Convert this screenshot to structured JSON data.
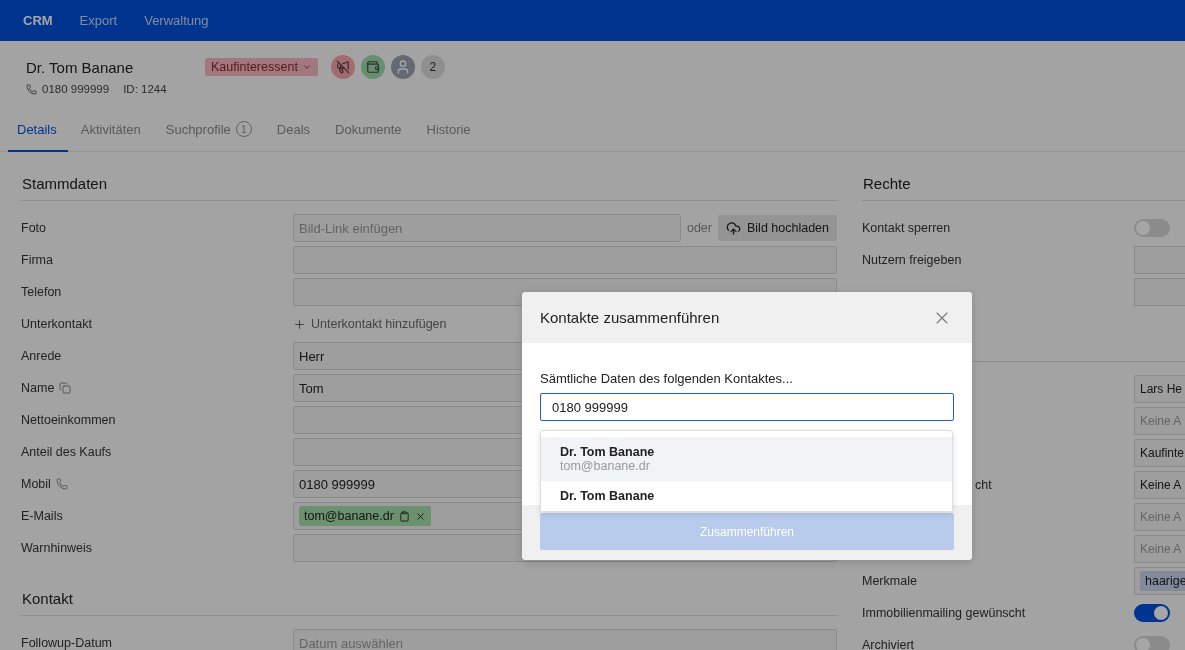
{
  "nav": [
    {
      "label": "CRM",
      "selected": true
    },
    {
      "label": "Export",
      "selected": false
    },
    {
      "label": "Verwaltung",
      "selected": false
    }
  ],
  "contact": {
    "name": "Dr. Tom Banane",
    "status": "Kaufinteressent",
    "badges": [
      {
        "kind": "megaphone-off"
      },
      {
        "kind": "wallet"
      },
      {
        "kind": "avatar"
      },
      {
        "kind": "count",
        "text": "2"
      }
    ],
    "phone": "0180 999999",
    "id": "ID: 1244"
  },
  "tabs": [
    {
      "label": "Details",
      "selected": true
    },
    {
      "label": "Aktivitäten",
      "selected": false
    },
    {
      "label": "Suchprofile",
      "count": "1",
      "selected": false
    },
    {
      "label": "Deals",
      "selected": false
    },
    {
      "label": "Dokumente",
      "selected": false
    },
    {
      "label": "Historie",
      "selected": false
    }
  ],
  "stammdaten": {
    "title": "Stammdaten",
    "rows": [
      {
        "label": "Foto",
        "kind": "photo",
        "placeholder": "Bild-Link einfügen",
        "or": "oder",
        "button": "Bild hochladen"
      },
      {
        "label": "Firma",
        "kind": "input"
      },
      {
        "label": "Telefon",
        "kind": "input"
      },
      {
        "label": "Unterkontakt",
        "kind": "add",
        "link": "Unterkontakt hinzufügen"
      },
      {
        "label": "Anrede",
        "kind": "input",
        "value": "Herr"
      },
      {
        "label": "Name",
        "label_action": {
          "kind": "copy"
        },
        "kind": "input",
        "value": "Tom"
      },
      {
        "label": "Nettoeinkommen",
        "kind": "input"
      },
      {
        "label": "Anteil des Kaufs",
        "kind": "input"
      },
      {
        "label": "Mobil",
        "label_action": {
          "kind": "phone"
        },
        "kind": "input",
        "value": "0180 999999"
      },
      {
        "label": "E-Mails",
        "kind": "tags",
        "tags": [
          "tom@banane.dr"
        ]
      },
      {
        "label": "Warnhinweis",
        "kind": "input"
      }
    ]
  },
  "kontakt": {
    "title": "Kontakt",
    "rows": [
      {
        "label": "Followup-Datum",
        "kind": "input",
        "placeholder": "Datum auswählen"
      }
    ]
  },
  "rechte": {
    "title": "Rechte",
    "rows": [
      {
        "label": "Kontakt sperren",
        "kind": "toggle",
        "on": false
      },
      {
        "label": "Nutzern freigeben",
        "kind": "input"
      },
      {
        "kind": "input"
      }
    ],
    "rows_2": [
      {
        "kind": "input",
        "value": "Lars He"
      },
      {
        "kind": "input",
        "placeholder": "Keine A"
      },
      {
        "kind": "input",
        "value": "Kaufinte"
      },
      {
        "label": "cht",
        "kind": "input",
        "value": "Keine A"
      },
      {
        "kind": "input",
        "placeholder": "Keine A"
      },
      {
        "kind": "input",
        "placeholder": "Keine A"
      },
      {
        "label": "Merkmale",
        "kind": "tags",
        "tags": [
          "haarige"
        ]
      },
      {
        "label": "Immobilienmailing gewünscht",
        "kind": "toggle",
        "on": true
      },
      {
        "label": "Archiviert",
        "kind": "toggle",
        "on": false
      }
    ]
  },
  "modal": {
    "title": "Kontakte zusammenführen",
    "prompt": "Sämtliche Daten des folgenden Kontaktes...",
    "value": "0180 999999",
    "suggestions": [
      {
        "name": "Dr. Tom Banane",
        "email": "tom@banane.dr",
        "selected": true
      },
      {
        "name": "Dr. Tom Banane",
        "selected": false
      }
    ],
    "button": {
      "label": "Zusammenführen",
      "disabled": true
    }
  }
}
